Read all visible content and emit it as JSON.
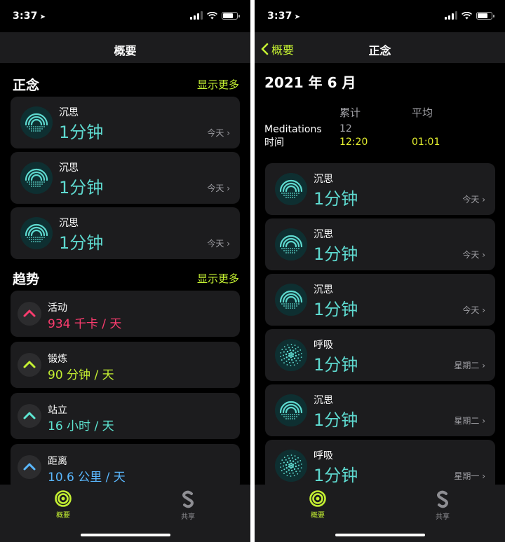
{
  "status": {
    "time": "3:37"
  },
  "left": {
    "nav_title": "概要",
    "mindfulness": {
      "title": "正念",
      "more": "显示更多",
      "items": [
        {
          "label": "沉思",
          "value": "1分钟",
          "date": "今天"
        },
        {
          "label": "沉思",
          "value": "1分钟",
          "date": "今天"
        },
        {
          "label": "沉思",
          "value": "1分钟",
          "date": "今天"
        }
      ]
    },
    "trends": {
      "title": "趋势",
      "more": "显示更多",
      "items": [
        {
          "label": "活动",
          "value": "934 千卡 / 天",
          "color": "#fa3c6e"
        },
        {
          "label": "锻炼",
          "value": "90 分钟 / 天",
          "color": "#c4f032"
        },
        {
          "label": "站立",
          "value": "16 小时 / 天",
          "color": "#5ee6d2"
        },
        {
          "label": "距离",
          "value": "10.6 公里 / 天",
          "color": "#5ab8ff"
        }
      ]
    }
  },
  "right": {
    "back_label": "概要",
    "nav_title": "正念",
    "month": "2021 年 6 月",
    "stats": {
      "col_total": "累计",
      "col_avg": "平均",
      "row_label_1": "Meditations",
      "row_label_2": "时间",
      "total_count": "12",
      "total_time": "12:20",
      "avg_time": "01:01"
    },
    "items": [
      {
        "label": "沉思",
        "value": "1分钟",
        "date": "今天",
        "kind": "meditate"
      },
      {
        "label": "沉思",
        "value": "1分钟",
        "date": "今天",
        "kind": "meditate"
      },
      {
        "label": "沉思",
        "value": "1分钟",
        "date": "今天",
        "kind": "meditate"
      },
      {
        "label": "呼吸",
        "value": "1分钟",
        "date": "星期二",
        "kind": "breathe"
      },
      {
        "label": "沉思",
        "value": "1分钟",
        "date": "星期二",
        "kind": "meditate"
      },
      {
        "label": "呼吸",
        "value": "1分钟",
        "date": "星期一",
        "kind": "breathe"
      }
    ]
  },
  "tabbar": {
    "summary": "概要",
    "sharing": "共享"
  },
  "colors": {
    "accent": "#c4f032",
    "teal": "#5ed9cf",
    "card": "#1c1c1e"
  }
}
